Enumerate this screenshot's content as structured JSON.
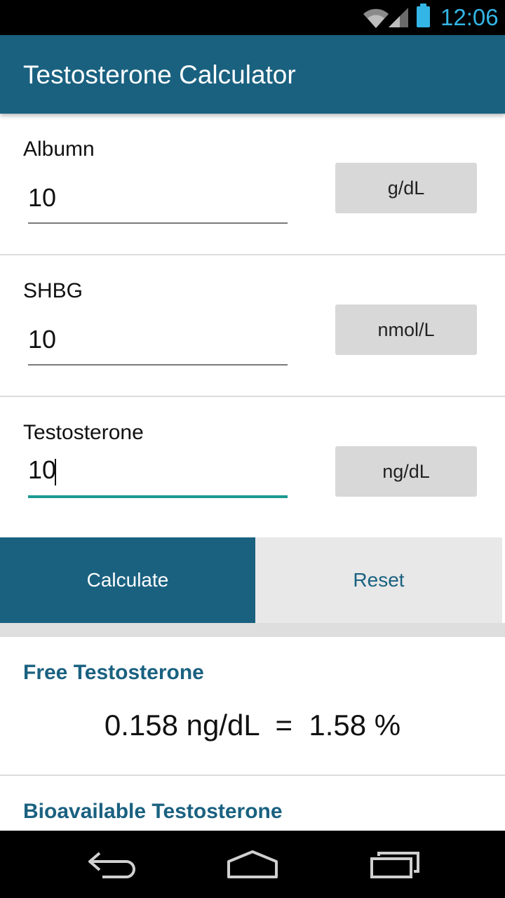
{
  "status_bar": {
    "time": "12:06",
    "icons": [
      "wifi-icon",
      "signal-icon",
      "battery-icon"
    ],
    "accent_color": "#33b5e5"
  },
  "app_bar": {
    "title": "Testosterone Calculator",
    "color": "#1a6180"
  },
  "inputs": [
    {
      "label": "Albumn",
      "value": "10",
      "unit": "g/dL",
      "focused": false
    },
    {
      "label": "SHBG",
      "value": "10",
      "unit": "nmol/L",
      "focused": false
    },
    {
      "label": "Testosterone",
      "value": "10",
      "unit": "ng/dL",
      "focused": true
    }
  ],
  "actions": {
    "calculate_label": "Calculate",
    "reset_label": "Reset"
  },
  "results": {
    "free": {
      "heading": "Free Testosterone",
      "value": "0.158 ng/dL  =  1.58 %"
    },
    "bioavailable": {
      "heading": "Bioavailable Testosterone"
    }
  },
  "nav_bar": {
    "icons": [
      "back-icon",
      "home-icon",
      "recents-icon"
    ]
  }
}
